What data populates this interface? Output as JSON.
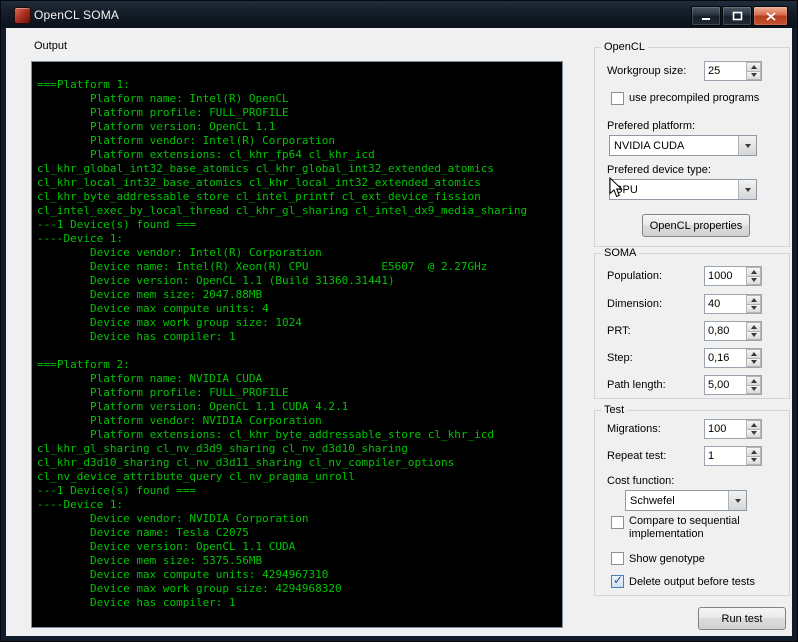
{
  "window": {
    "title": "OpenCL SOMA"
  },
  "colors": {
    "console_bg": "#000000",
    "console_text": "#00c400"
  },
  "output": {
    "label": "Output",
    "console_lines": [
      "===Platform 1:",
      "        Platform name: Intel(R) OpenCL",
      "        Platform profile: FULL_PROFILE",
      "        Platform version: OpenCL 1.1",
      "        Platform vendor: Intel(R) Corporation",
      "        Platform extensions: cl_khr_fp64 cl_khr_icd",
      "cl_khr_global_int32_base_atomics cl_khr_global_int32_extended_atomics",
      "cl_khr_local_int32_base_atomics cl_khr_local_int32_extended_atomics",
      "cl_khr_byte_addressable_store cl_intel_printf cl_ext_device_fission",
      "cl_intel_exec_by_local_thread cl_khr_gl_sharing cl_intel_dx9_media_sharing",
      "---1 Device(s) found ===",
      "----Device 1:",
      "        Device vendor: Intel(R) Corporation",
      "        Device name: Intel(R) Xeon(R) CPU           E5607  @ 2.27GHz",
      "        Device version: OpenCL 1.1 (Build 31360.31441)",
      "        Device mem size: 2047.88MB",
      "        Device max compute units: 4",
      "        Device max work group size: 1024",
      "        Device has compiler: 1",
      "",
      "===Platform 2:",
      "        Platform name: NVIDIA CUDA",
      "        Platform profile: FULL_PROFILE",
      "        Platform version: OpenCL 1.1 CUDA 4.2.1",
      "        Platform vendor: NVIDIA Corporation",
      "        Platform extensions: cl_khr_byte_addressable_store cl_khr_icd",
      "cl_khr_gl_sharing cl_nv_d3d9_sharing cl_nv_d3d10_sharing",
      "cl_khr_d3d10_sharing cl_nv_d3d11_sharing cl_nv_compiler_options",
      "cl_nv_device_attribute_query cl_nv_pragma_unroll",
      "---1 Device(s) found ===",
      "----Device 1:",
      "        Device vendor: NVIDIA Corporation",
      "        Device name: Tesla C2075",
      "        Device version: OpenCL 1.1 CUDA",
      "        Device mem size: 5375.56MB",
      "        Device max compute units: 4294967310",
      "        Device max work group size: 4294968320",
      "        Device has compiler: 1"
    ]
  },
  "opencl": {
    "title": "OpenCL",
    "workgroup_label": "Workgroup size:",
    "workgroup_value": "25",
    "precompiled": {
      "label": "use precompiled programs",
      "checked": false
    },
    "platform_label": "Prefered platform:",
    "platform_value": "NVIDIA CUDA",
    "device_type_label": "Prefered device type:",
    "device_type_value": "GPU",
    "properties_button": "OpenCL properties"
  },
  "soma": {
    "title": "SOMA",
    "fields": [
      {
        "label": "Population:",
        "value": "1000"
      },
      {
        "label": "Dimension:",
        "value": "40"
      },
      {
        "label": "PRT:",
        "value": "0,80"
      },
      {
        "label": "Step:",
        "value": "0,16"
      },
      {
        "label": "Path length:",
        "value": "5,00"
      }
    ]
  },
  "test": {
    "title": "Test",
    "fields": [
      {
        "label": "Migrations:",
        "value": "100"
      },
      {
        "label": "Repeat test:",
        "value": "1"
      }
    ],
    "cost_function_label": "Cost function:",
    "cost_function_value": "Schwefel",
    "checkboxes": [
      {
        "label": "Compare to sequential implementation",
        "checked": false
      },
      {
        "label": "Show genotype",
        "checked": false
      },
      {
        "label": "Delete output before tests",
        "checked": true
      }
    ]
  },
  "run_button": "Run test"
}
